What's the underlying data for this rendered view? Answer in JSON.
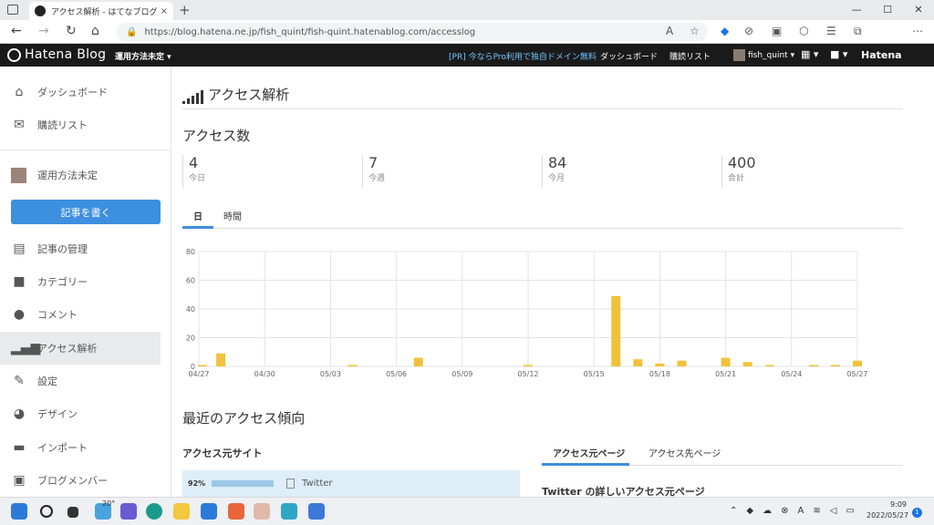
{
  "browser": {
    "tab_title": "アクセス解析 - はてなブログ",
    "tab_close": "×",
    "new_tab": "+",
    "url": "https://blog.hatena.ne.jp/fish_quint/fish-quint.hatenablog.com/accesslog",
    "window_controls": [
      "—",
      "☐",
      "✕"
    ]
  },
  "header": {
    "logo": "Hatena Blog",
    "blog_selector": "運用方法未定 ▾",
    "promo": "[PR] 今ならPro利用で独自ドメイン無料",
    "dashboard": "ダッシュボード",
    "subscriptions": "購読リスト",
    "user": "fish_quint ▾",
    "apps_menu": "▦ ▾",
    "notify": "■ ▾",
    "hatena": "Hatena"
  },
  "sidebar": {
    "items": [
      {
        "label": "ダッシュボード",
        "icon": "home-icon"
      },
      {
        "label": "購読リスト",
        "icon": "subscribe-icon"
      },
      {
        "label": "運用方法未定",
        "icon": "blog-avatar"
      },
      {
        "label": "記事の管理",
        "icon": "document-icon"
      },
      {
        "label": "カテゴリー",
        "icon": "folder-icon"
      },
      {
        "label": "コメント",
        "icon": "comment-icon"
      },
      {
        "label": "アクセス解析",
        "icon": "bar-chart-icon"
      },
      {
        "label": "設定",
        "icon": "wrench-icon"
      },
      {
        "label": "デザイン",
        "icon": "palette-icon"
      },
      {
        "label": "インポート",
        "icon": "truck-icon"
      },
      {
        "label": "ブログメンバー",
        "icon": "members-icon"
      }
    ],
    "write_button": "記事を書く"
  },
  "main": {
    "title": "アクセス解析",
    "count_heading": "アクセス数",
    "stats": [
      {
        "value": "4",
        "label": "今日"
      },
      {
        "value": "7",
        "label": "今週"
      },
      {
        "value": "84",
        "label": "今月"
      },
      {
        "value": "400",
        "label": "合計"
      }
    ],
    "tabs": [
      "日",
      "時間"
    ],
    "recent_heading": "最近のアクセス傾向",
    "sources_heading": "アクセス元サイト",
    "source_row": {
      "percent": "92%",
      "share": 0.92,
      "name": "Twitter"
    },
    "ref_tabs": [
      "アクセス元ページ",
      "アクセス先ページ"
    ],
    "ref_detail": "Twitter の詳しいアクセス元ページ"
  },
  "chart_data": {
    "type": "bar",
    "ylim": [
      0,
      80
    ],
    "yticks": [
      0,
      20,
      40,
      60,
      80
    ],
    "xtick_labels": [
      "04/27",
      "04/30",
      "05/03",
      "05/06",
      "05/09",
      "05/12",
      "05/15",
      "05/18",
      "05/21",
      "05/24",
      "05/27"
    ],
    "categories": [
      "04/27",
      "04/28",
      "04/29",
      "04/30",
      "05/01",
      "05/02",
      "05/03",
      "05/04",
      "05/05",
      "05/06",
      "05/07",
      "05/08",
      "05/09",
      "05/10",
      "05/11",
      "05/12",
      "05/13",
      "05/14",
      "05/15",
      "05/16",
      "05/17",
      "05/18",
      "05/19",
      "05/20",
      "05/21",
      "05/22",
      "05/23",
      "05/24",
      "05/25",
      "05/26",
      "05/27"
    ],
    "values": [
      1,
      9,
      0,
      0,
      0,
      0,
      0,
      1,
      0,
      0,
      6,
      0,
      0,
      0,
      0,
      1,
      0,
      0,
      0,
      49,
      5,
      2,
      4,
      0,
      6,
      3,
      1,
      0,
      1,
      1,
      4
    ],
    "bar_color": "#f0c23b"
  },
  "taskbar": {
    "weather": "20°",
    "time": "9:09",
    "date": "2022/05/27",
    "badge": "1"
  }
}
